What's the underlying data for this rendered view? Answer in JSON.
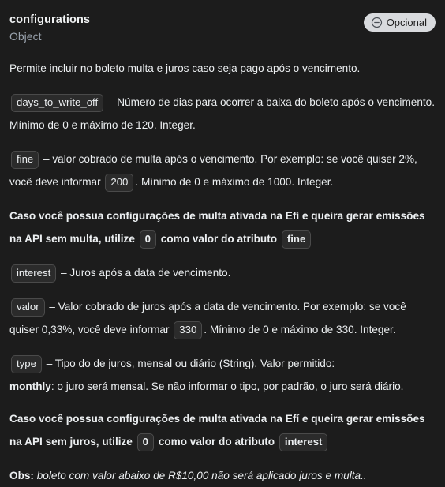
{
  "header": {
    "property_name": "configurations",
    "property_type": "Object",
    "badge": {
      "label": "Opcional",
      "icon": "minus-circle-icon",
      "bg_color": "#d8dadd",
      "text_color": "#1f1f1f"
    }
  },
  "theme": {
    "background": "#1c1c1c",
    "text": "#eceff1",
    "muted_text": "#9aa3ae",
    "code_bg": "#2b2b2b",
    "code_border": "#4a4a4a"
  },
  "body": {
    "intro": "Permite incluir no boleto multa e juros caso seja pago após o vencimento.",
    "days_to_write_off": {
      "code": "days_to_write_off",
      "text": " – Número de dias para ocorrer a baixa do boleto após o vencimento. Mínimo de 0 e máximo de 120. Integer."
    },
    "fine": {
      "code": "fine",
      "text_before": " – valor cobrado de multa após o vencimento. Por exemplo: se você quiser 2%, você deve informar ",
      "value_code": "200",
      "text_after": ". Mínimo de 0 e máximo de 1000. Integer."
    },
    "fine_note": {
      "part1": "Caso você possua configurações de multa ativada na Efí e queira gerar emissões na API sem multa, utilize ",
      "zero_code": "0",
      "part2": " como valor do atributo ",
      "attr_code": "fine"
    },
    "interest": {
      "code": "interest",
      "text": " – Juros após a data de vencimento."
    },
    "valor": {
      "code": "valor",
      "text_before": " – Valor cobrado de juros após a data de vencimento. Por exemplo: se você quiser 0,33%, você deve informar ",
      "value_code": "330",
      "text_after": ". Mínimo de 0 e máximo de 330. Integer."
    },
    "type": {
      "code": "type",
      "text": " – Tipo do de juros, mensal ou diário (String). Valor permitido:",
      "monthly_label": "monthly",
      "monthly_text": ": o juro será mensal. Se não informar o tipo, por padrão, o juro será diário."
    },
    "interest_note": {
      "part1": "Caso você possua configurações de multa ativada na Efí e queira gerar emissões na API sem juros, utilize ",
      "zero_code": "0",
      "part2": " como valor do atributo ",
      "attr_code": "interest"
    },
    "obs": {
      "label": "Obs:",
      "text": " boleto com valor abaixo de R$10,00 não será aplicado juros e multa.."
    }
  }
}
